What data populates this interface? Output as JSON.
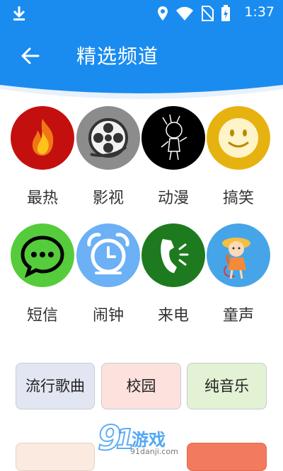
{
  "status": {
    "time": "1:37"
  },
  "toolbar": {
    "title": "精选频道"
  },
  "channels": [
    {
      "label": "最热",
      "icon": "fire-icon"
    },
    {
      "label": "影视",
      "icon": "film-reel-icon"
    },
    {
      "label": "动漫",
      "icon": "cartoon-character-icon"
    },
    {
      "label": "搞笑",
      "icon": "smiley-face-icon"
    },
    {
      "label": "短信",
      "icon": "message-bubble-icon"
    },
    {
      "label": "闹钟",
      "icon": "alarm-clock-icon"
    },
    {
      "label": "来电",
      "icon": "phone-ringing-icon"
    },
    {
      "label": "童声",
      "icon": "child-girl-icon"
    }
  ],
  "tags": [
    {
      "label": "流行歌曲",
      "bg": "#e2e6f2"
    },
    {
      "label": "校园",
      "bg": "#fde1dc"
    },
    {
      "label": "纯音乐",
      "bg": "#e3f1d4"
    }
  ],
  "colors": {
    "primary": "#1a8cf0"
  },
  "watermark": {
    "brand": "游戏",
    "site": "91danji.com"
  }
}
